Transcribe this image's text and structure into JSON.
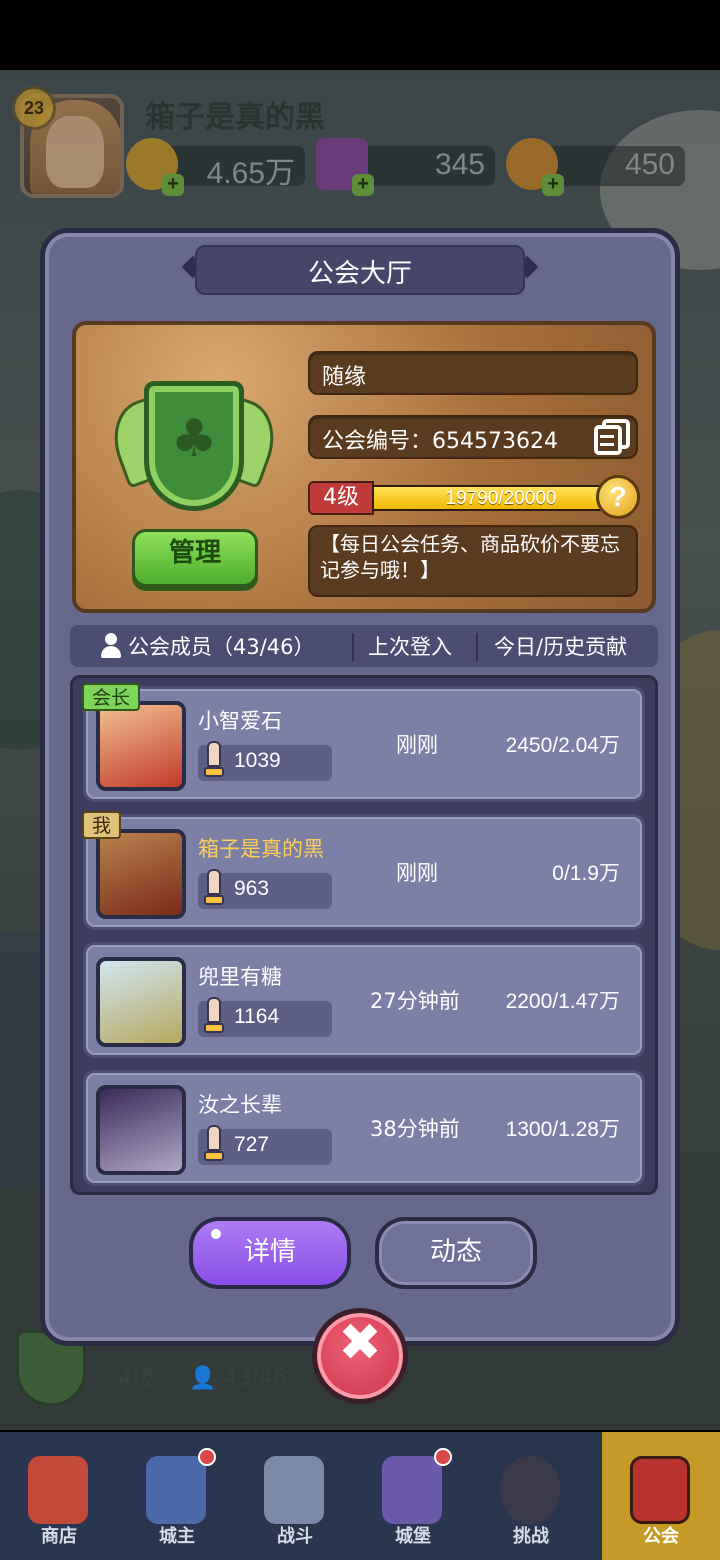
{
  "player": {
    "level": "23",
    "name": "箱子是真的黑",
    "resources": [
      {
        "icon": "gold-coin-icon",
        "value": "4.65万"
      },
      {
        "icon": "purple-gem-icon",
        "value": "345"
      },
      {
        "icon": "star-coin-icon",
        "value": "450"
      }
    ]
  },
  "panel": {
    "title": "公会大厅",
    "guild": {
      "name": "随缘",
      "id_label": "公会编号：654573624",
      "level": "4级",
      "exp_text": "19790/20000",
      "exp_fraction": 0.9895,
      "help": "?",
      "manage_label": "管理",
      "notice": "【每日公会任务、商品砍价不要忘记参与哦！】"
    },
    "member_header": {
      "members": "公会成员（43/46）",
      "last_login": "上次登入",
      "contribution": "今日/历史贡献"
    },
    "members": [
      {
        "role": "会长",
        "name": "小智爱石",
        "power": "1039",
        "last_login": "刚刚",
        "contribution": "2450/2.04万"
      },
      {
        "role": "我",
        "name": "箱子是真的黑",
        "power": "963",
        "last_login": "刚刚",
        "contribution": "0/1.9万"
      },
      {
        "role": "",
        "name": "兜里有糖",
        "power": "1164",
        "last_login": "27分钟前",
        "contribution": "2200/1.47万"
      },
      {
        "role": "",
        "name": "汝之长辈",
        "power": "727",
        "last_login": "38分钟前",
        "contribution": "1300/1.28万"
      }
    ],
    "buttons": {
      "details": "详情",
      "activity": "动态"
    },
    "close": "✖"
  },
  "background_guild": {
    "level": "4级",
    "members": "43/46"
  },
  "nav": [
    {
      "label": "商店",
      "icon": "shop-icon",
      "dot": false,
      "active": false
    },
    {
      "label": "城主",
      "icon": "crown-icon",
      "dot": true,
      "active": false
    },
    {
      "label": "战斗",
      "icon": "swords-icon",
      "dot": false,
      "active": false
    },
    {
      "label": "城堡",
      "icon": "castle-icon",
      "dot": true,
      "active": false
    },
    {
      "label": "挑战",
      "icon": "demon-icon",
      "dot": false,
      "active": false
    },
    {
      "label": "公会",
      "icon": "guild-banner-icon",
      "dot": false,
      "active": true
    }
  ],
  "colors": {
    "accent_purple": "#8a4ee8",
    "me_name": "#ffcc55",
    "leader_tag": "#7fd45a",
    "exp_bar": "#f2b800"
  }
}
